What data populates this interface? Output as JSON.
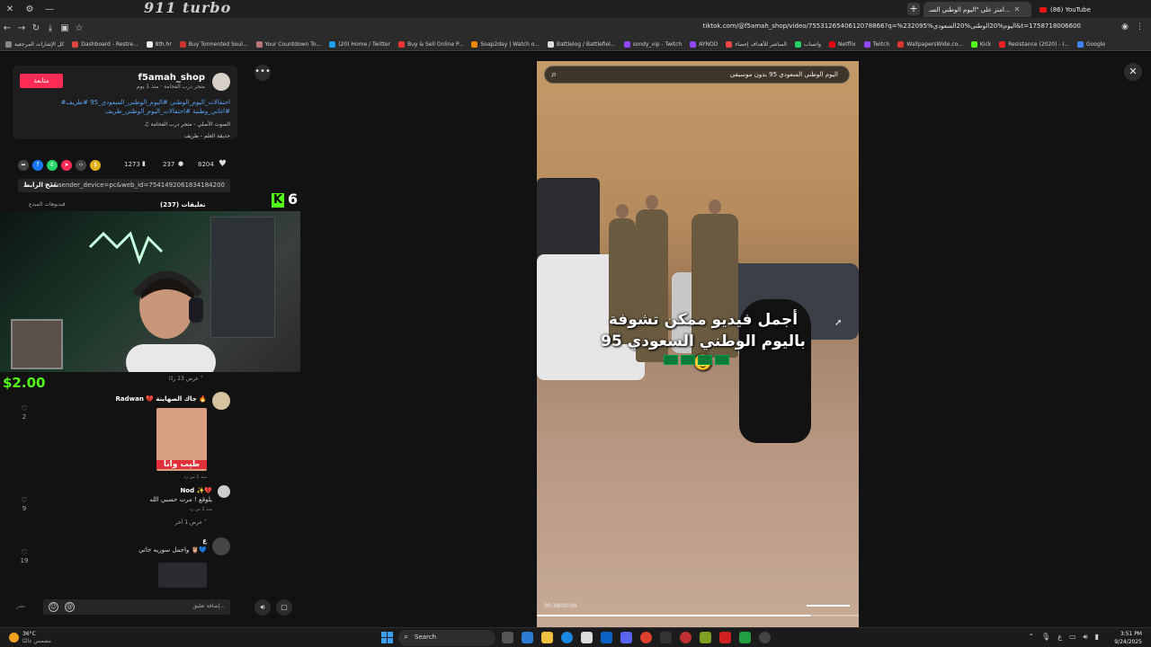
{
  "browser": {
    "brand": "911 turbo",
    "tabs": [
      {
        "label": "امتز على \"اليوم الوطني السـ...",
        "active": true
      },
      {
        "label": "(86) YouTube",
        "active": false
      }
    ],
    "url": "tiktok.com/@f5amah_shop/video/7553126540612078866?q=%23اليوم%20الوطني%20السعودي%2095&t=1758718006600",
    "bookmarks": [
      "كل الإشارات المرجعية",
      "Dashboard - Restre...",
      "8th.hr",
      "Buy Tormented Soul...",
      "Your Countdown To...",
      "(20) Home / Twitter",
      "Buy & Sell Online P...",
      "Soap2day | Watch o...",
      "Battlelog / Battlefiel...",
      "sondy_vip - Twitch",
      "AYNOD",
      "المباشر للأهداف إحصاء",
      "واتساب",
      "Netflix",
      "Twitch",
      "WallpapersWide.co...",
      "Kick",
      "Resistance (2020) - I...",
      "Google"
    ]
  },
  "creator": {
    "name": "f5amah_shop",
    "subtitle": "متجر درب الفخامة · منذ 1 يوم",
    "follow_label": "متابعة",
    "description": "#احتفالات_اليوم_الوطني #اليوم_الوطني_السعودي_95 #طريف #اغاني_وطنية #احتفالات_اليوم_الوطني_طريف",
    "sound": "♫ الصوت الأصلي - متجر درب الفخامة",
    "tag": "حديقة العلم - طريف"
  },
  "stats": {
    "likes": "8204",
    "comments": "237",
    "saves": "1273"
  },
  "link": {
    "text": "=1&sender_device=pc&web_id=7541492061834184200",
    "copy_label": "نسخ الرابط"
  },
  "tabs": {
    "comments_label": "تعليقات (237)",
    "creator_videos_label": "فيديوهات المبدع"
  },
  "stream": {
    "kick_count": "6",
    "donation": "$2.00"
  },
  "comments": [
    {
      "replies_toggle": "عرض 13 ردًا"
    },
    {
      "author": "Radwan 💔 جاك الصهاينة 🔥",
      "sticker_label": "طيب وانا",
      "meta": "منذ 1 س   رد",
      "likes": "2"
    },
    {
      "author": "Nod ✨💔",
      "text": "يلوقع ! مرت حسبي الله",
      "meta": "منذ 1 س   رد",
      "replies_toggle": "عرض 1 آخر",
      "likes": "9"
    },
    {
      "author": "ع",
      "text": "واجمل سوريه جاتي 🦉💙",
      "likes": "19"
    }
  ],
  "composer": {
    "placeholder": "إضافة تعليق...",
    "post_label": "نشر"
  },
  "video": {
    "search_text": "اليوم الوطني السعودي 95 بدون موسيقى",
    "caption_line1": "أجمل فيديو ممكن تشوفة",
    "caption_line2": "باليوم الوطني السعودي 95 🥹",
    "time": "00:38/00:06",
    "progress_fraction": 0.85
  },
  "taskbar": {
    "temperature": "36°C",
    "weather_desc": "مشمس غالبًا",
    "search_label": "Search",
    "time": "3:51 PM",
    "date": "9/24/2025",
    "lang": "ع"
  }
}
